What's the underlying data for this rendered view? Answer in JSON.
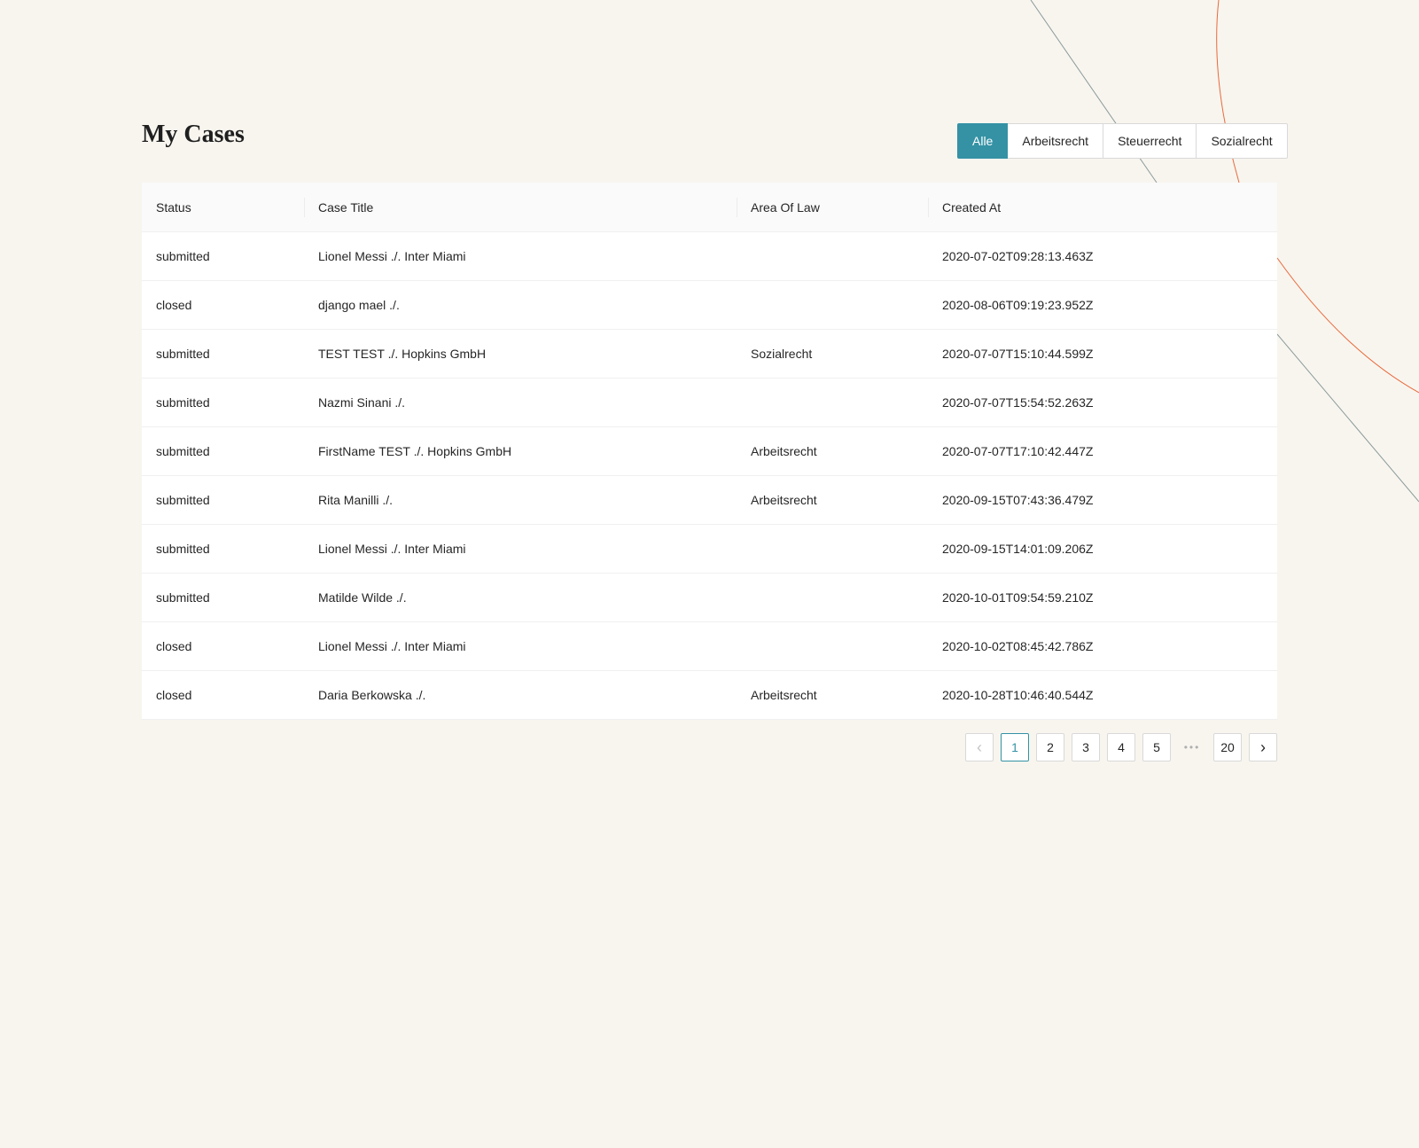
{
  "page": {
    "title": "My Cases"
  },
  "filters": [
    {
      "label": "Alle",
      "active": true
    },
    {
      "label": "Arbeitsrecht",
      "active": false
    },
    {
      "label": "Steuerrecht",
      "active": false
    },
    {
      "label": "Sozialrecht",
      "active": false
    }
  ],
  "table": {
    "columns": [
      "Status",
      "Case Title",
      "Area Of Law",
      "Created At"
    ],
    "rows": [
      [
        "submitted",
        "Lionel Messi ./. Inter Miami",
        "",
        "2020-07-02T09:28:13.463Z"
      ],
      [
        "closed",
        "django mael ./.",
        "",
        "2020-08-06T09:19:23.952Z"
      ],
      [
        "submitted",
        "TEST TEST ./. Hopkins GmbH",
        "Sozialrecht",
        "2020-07-07T15:10:44.599Z"
      ],
      [
        "submitted",
        "Nazmi Sinani ./.",
        "",
        "2020-07-07T15:54:52.263Z"
      ],
      [
        "submitted",
        "FirstName TEST ./. Hopkins GmbH",
        "Arbeitsrecht",
        "2020-07-07T17:10:42.447Z"
      ],
      [
        "submitted",
        "Rita Manilli ./.",
        "Arbeitsrecht",
        "2020-09-15T07:43:36.479Z"
      ],
      [
        "submitted",
        "Lionel Messi ./. Inter Miami",
        "",
        "2020-09-15T14:01:09.206Z"
      ],
      [
        "submitted",
        "Matilde Wilde ./.",
        "",
        "2020-10-01T09:54:59.210Z"
      ],
      [
        "closed",
        "Lionel Messi ./. Inter Miami",
        "",
        "2020-10-02T08:45:42.786Z"
      ],
      [
        "closed",
        "Daria Berkowska ./.",
        "Arbeitsrecht",
        "2020-10-28T10:46:40.544Z"
      ]
    ]
  },
  "pagination": {
    "prev_icon": "chevron-left-icon",
    "next_icon": "chevron-right-icon",
    "pages": [
      "1",
      "2",
      "3",
      "4",
      "5"
    ],
    "ellipsis": "•••",
    "last_page": "20",
    "current": "1"
  },
  "colors": {
    "accent": "#3592a5",
    "background": "#f8f5ef",
    "decor_orange": "#e8693a",
    "decor_gray": "#8a9a9a"
  }
}
